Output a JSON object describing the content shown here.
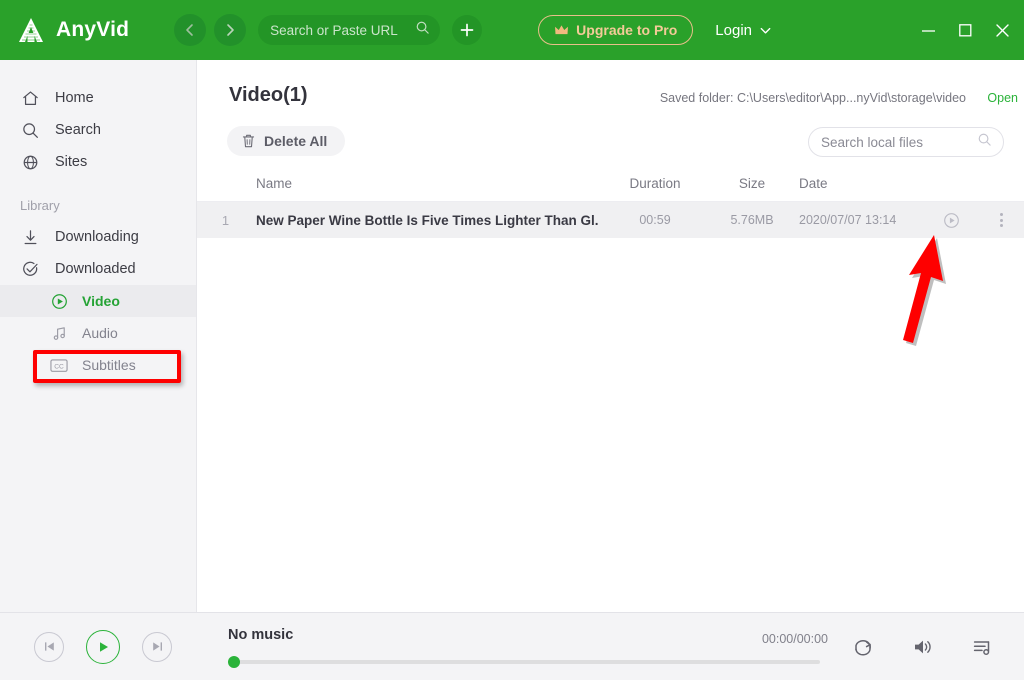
{
  "app": {
    "name": "AnyVid"
  },
  "header": {
    "nav": {
      "back": "back-arrow",
      "forward": "forward-arrow"
    },
    "url_input": {
      "value": "",
      "placeholder": "Search or Paste URL"
    },
    "add_button": "+",
    "upgrade_label": "Upgrade to Pro",
    "login_label": "Login",
    "window": {
      "minimize": "—",
      "maximize": "□",
      "close": "✕"
    },
    "colors": {
      "header_bg": "#2aa12a",
      "upgrade_gold": "#f3cb98"
    }
  },
  "sidebar": {
    "items": [
      {
        "label": "Home",
        "icon": "home-icon"
      },
      {
        "label": "Search",
        "icon": "search-icon"
      },
      {
        "label": "Sites",
        "icon": "globe-icon"
      }
    ],
    "section_label": "Library",
    "library": [
      {
        "label": "Downloading",
        "icon": "download-icon"
      },
      {
        "label": "Downloaded",
        "icon": "check-circle-icon"
      }
    ],
    "sub_items": [
      {
        "label": "Video",
        "icon": "play-circle-icon",
        "active": true
      },
      {
        "label": "Audio",
        "icon": "music-note-icon",
        "active": false
      },
      {
        "label": "Subtitles",
        "icon": "cc-icon",
        "active": false
      }
    ],
    "highlight_color": "#fe0000",
    "active_color": "#25a335"
  },
  "content": {
    "title": "Video(1)",
    "saved_folder_label": "Saved folder: C:\\Users\\editor\\App...nyVid\\storage\\video",
    "open_link": "Open",
    "delete_all_label": "Delete All",
    "local_search": {
      "value": "",
      "placeholder": "Search local files"
    },
    "table": {
      "columns": [
        "",
        "Name",
        "Duration",
        "Size",
        "Date",
        "",
        ""
      ],
      "rows": [
        {
          "index": "1",
          "name": "New Paper Wine Bottle Is Five Times Lighter Than Gl...",
          "duration": "00:59",
          "size": "5.76MB",
          "date": "2020/07/07 13:14",
          "play_icon": "play-circle-icon",
          "menu_icon": "more-vertical-icon"
        }
      ]
    }
  },
  "player": {
    "previous": "skip-back-icon",
    "play": "play-icon",
    "next": "skip-forward-icon",
    "track_title": "No music",
    "time": "00:00/00:00",
    "progress_percent": 0,
    "repeat": "repeat-icon",
    "volume": "volume-icon",
    "playlist": "playlist-icon",
    "accent": "#2bb33a"
  }
}
